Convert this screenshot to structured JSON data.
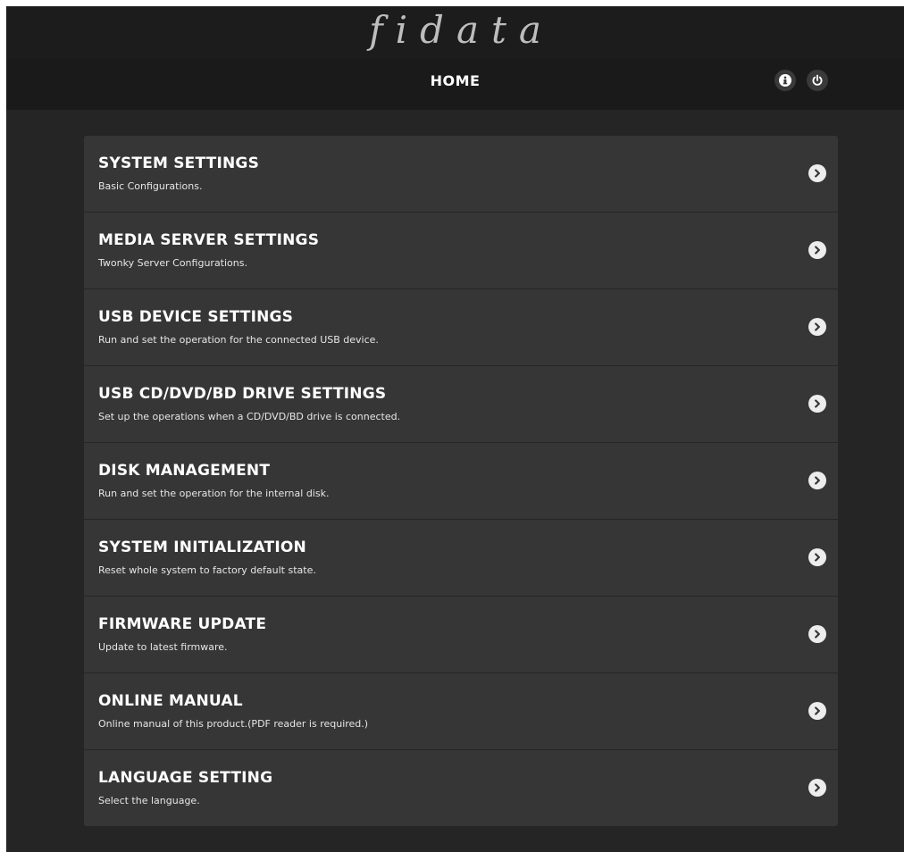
{
  "brand": {
    "logo_text": "fidata"
  },
  "header": {
    "title": "HOME",
    "icons": [
      "info-icon",
      "power-icon"
    ]
  },
  "menu": {
    "items": [
      {
        "title": "SYSTEM SETTINGS",
        "description": "Basic Configurations."
      },
      {
        "title": "MEDIA SERVER SETTINGS",
        "description": "Twonky Server Configurations."
      },
      {
        "title": "USB DEVICE SETTINGS",
        "description": "Run and set the operation for the connected USB device."
      },
      {
        "title": "USB CD/DVD/BD DRIVE SETTINGS",
        "description": "Set up the operations when a CD/DVD/BD drive is connected."
      },
      {
        "title": "DISK MANAGEMENT",
        "description": "Run and set the operation for the internal disk."
      },
      {
        "title": "SYSTEM INITIALIZATION",
        "description": "Reset whole system to factory default state."
      },
      {
        "title": "FIRMWARE UPDATE",
        "description": "Update to latest firmware."
      },
      {
        "title": "ONLINE MANUAL",
        "description": "Online manual of this product.(PDF reader is required.)"
      },
      {
        "title": "LANGUAGE SETTING",
        "description": "Select the language."
      }
    ]
  },
  "colors": {
    "page_bg": "#252525",
    "header_bg": "#1a1a1a",
    "panel_bg": "#363636",
    "text": "#ffffff"
  }
}
